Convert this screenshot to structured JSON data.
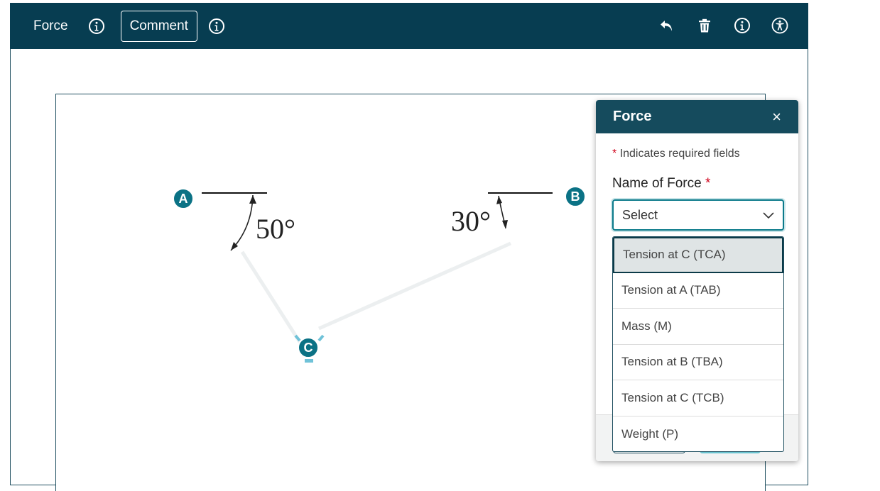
{
  "toolbar": {
    "force_label": "Force",
    "comment_label": "Comment",
    "icons": [
      "info-icon",
      "undo-icon",
      "trash-icon",
      "accessibility-icon"
    ]
  },
  "diagram": {
    "angle_a": "50°",
    "angle_b": "30°",
    "points": {
      "a": "A",
      "b": "B",
      "c": "C"
    }
  },
  "panel": {
    "title": "Force",
    "close": "×",
    "required_star": "*",
    "required_note": "Indicates required fields",
    "field_label": "Name of Force",
    "select_value": "Select",
    "options": [
      "Tension at C (TCA)",
      "Tension at A (TAB)",
      "Mass (M)",
      "Tension at B (TBA)",
      "Tension at C (TCB)",
      "Weight (P)"
    ]
  },
  "colors": {
    "toolbar_bg": "#073d51",
    "panel_header": "#154b5d",
    "marker": "#0b7285",
    "accent": "#0b7a8a"
  }
}
